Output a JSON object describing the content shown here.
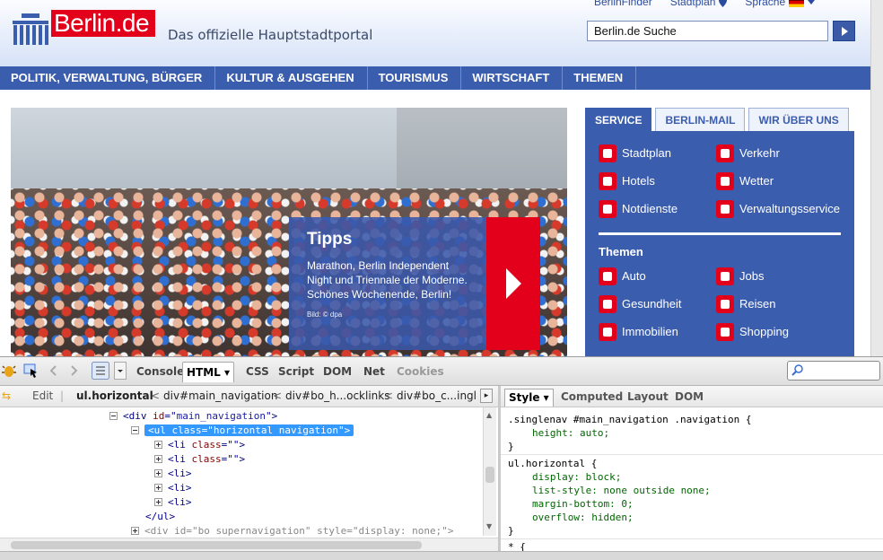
{
  "site": {
    "logo_text": "Berlin.de",
    "tagline": "Das offizielle Hauptstadtportal",
    "top_links": [
      "BerlinFinder",
      "Stadtplan",
      "Sprache"
    ],
    "search_value": "Berlin.de Suche",
    "nav": [
      "POLITIK, VERWALTUNG, BÜRGER",
      "KULTUR & AUSGEHEN",
      "TOURISMUS",
      "WIRTSCHAFT",
      "THEMEN"
    ],
    "tipps": {
      "title": "Tipps",
      "text": "Marathon, Berlin Independent Night und Triennale der Moderne. Schönes Wochenende, Berlin!",
      "credit": "Bild: © dpa"
    },
    "service_tabs": [
      "SERVICE",
      "BERLIN-MAIL",
      "WIR ÜBER UNS"
    ],
    "service_items": [
      "Stadtplan",
      "Verkehr",
      "Hotels",
      "Wetter",
      "Notdienste",
      "Verwaltungsservice"
    ],
    "themen_heading": "Themen",
    "themen_items": [
      "Auto",
      "Jobs",
      "Gesundheit",
      "Reisen",
      "Immobilien",
      "Shopping"
    ],
    "colors": {
      "brand_red": "#e2001a",
      "brand_blue": "#3a5dae"
    }
  },
  "firebug": {
    "tabs": [
      "Console",
      "HTML",
      "CSS",
      "Script",
      "DOM",
      "Net",
      "Cookies"
    ],
    "active_tab": "HTML",
    "breadcrumb": {
      "edit": "Edit",
      "items": [
        "ul.horizontal",
        "div#main_navigation",
        "div#bo_h...ocklinks",
        "div#bo_c...ingl"
      ]
    },
    "tree": [
      {
        "open": "<div",
        "attr": "id",
        "val": "main_navigation",
        "close": ">"
      },
      {
        "open": "<ul",
        "attr": "class",
        "val": "horizontal navigation",
        "close": ">"
      },
      {
        "open": "<li",
        "attr": "class",
        "val": "",
        "close": ">"
      },
      {
        "open": "<li",
        "attr": "class",
        "val": "",
        "close": ">"
      },
      {
        "text": "<li>"
      },
      {
        "text": "<li>"
      },
      {
        "text": "<li>"
      },
      {
        "text": "</ul>"
      },
      {
        "open": "<div",
        "attr": "id",
        "val": "bo_supernavigation",
        "attr2": "style",
        "val2": "display: none;",
        "close": ">"
      }
    ],
    "side_tabs": [
      "Style",
      "Computed",
      "Layout",
      "DOM"
    ],
    "css_rules": [
      {
        "selector": ".singlenav #main_navigation .navigation {",
        "props": [
          "height: auto;"
        ]
      },
      {
        "selector": "ul.horizontal {",
        "props": [
          "display: block;",
          "list-style: none outside none;",
          "margin-bottom: 0;",
          "overflow: hidden;"
        ]
      },
      {
        "selector": "* {",
        "props": []
      }
    ],
    "closing_brace": "}"
  }
}
